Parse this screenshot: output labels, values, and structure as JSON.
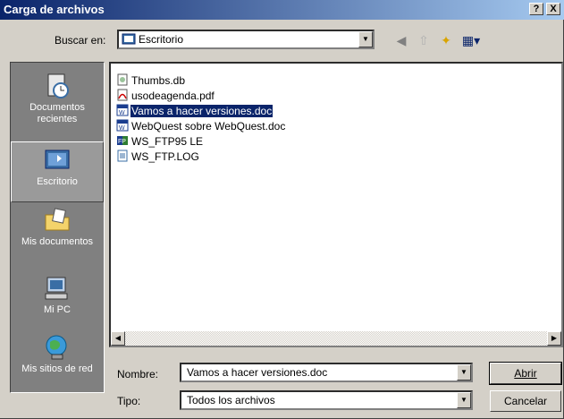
{
  "window": {
    "title": "Carga de archivos"
  },
  "titlebar_buttons": {
    "help": "?",
    "close": "X"
  },
  "lookin": {
    "label": "Buscar en:",
    "value": "Escritorio"
  },
  "places": [
    {
      "label": "Documentos recientes",
      "icon": "recent-documents-icon"
    },
    {
      "label": "Escritorio",
      "icon": "desktop-icon",
      "selected": true
    },
    {
      "label": "Mis documentos",
      "icon": "my-documents-icon"
    },
    {
      "label": "Mi PC",
      "icon": "my-computer-icon"
    },
    {
      "label": "Mis sitios de red",
      "icon": "network-places-icon"
    }
  ],
  "files": [
    {
      "name": "Thumbs.db",
      "icon": "db-file-icon"
    },
    {
      "name": "usodeagenda.pdf",
      "icon": "pdf-file-icon"
    },
    {
      "name": "Vamos a hacer versiones.doc",
      "icon": "word-doc-icon",
      "selected": true
    },
    {
      "name": "WebQuest sobre WebQuest.doc",
      "icon": "word-doc-icon"
    },
    {
      "name": "WS_FTP95 LE",
      "icon": "ftp-app-icon"
    },
    {
      "name": "WS_FTP.LOG",
      "icon": "log-file-icon"
    }
  ],
  "filename": {
    "label": "Nombre:",
    "value": "Vamos a hacer versiones.doc"
  },
  "filetype": {
    "label": "Tipo:",
    "value": "Todos los archivos"
  },
  "buttons": {
    "open": "Abrir",
    "cancel": "Cancelar"
  }
}
